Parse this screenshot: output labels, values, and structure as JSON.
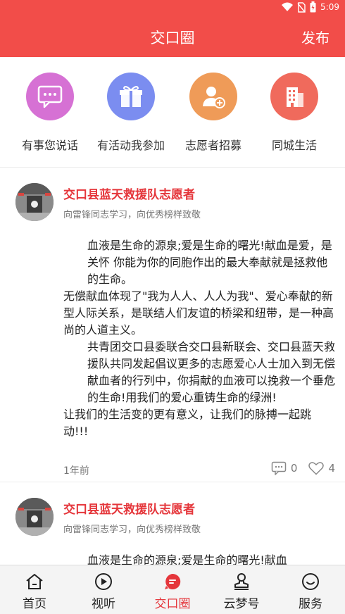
{
  "status_bar": {
    "time": "5:09"
  },
  "header": {
    "title": "交口圈",
    "publish_label": "发布"
  },
  "quick_links": [
    {
      "label": "有事您说话",
      "icon": "chat-bubble-icon",
      "color": "#d671d4"
    },
    {
      "label": "有活动我参加",
      "icon": "gift-icon",
      "color": "#7b8df0"
    },
    {
      "label": "志愿者招募",
      "icon": "add-person-icon",
      "color": "#ef9b58"
    },
    {
      "label": "同城生活",
      "icon": "building-icon",
      "color": "#f06a5c"
    }
  ],
  "posts": [
    {
      "author": "交口县蓝天救援队志愿者",
      "subtitle": "向雷锋同志学习，向优秀榜样致敬",
      "paragraphs": [
        "血液是生命的源泉;爱是生命的曙光!献血是爱，是关怀 你能为你的同胞作出的最大奉献就是拯救他的生命。",
        "无偿献血体现了\"我为人人、人人为我\"、爱心奉献的新型人际关系，是联结人们友谊的桥梁和纽带，是一种高尚的人道主义。",
        "共青团交口县委联合交口县新联会、交口县蓝天救援队共同发起倡议更多的志愿爱心人士加入到无偿献血者的行列中，你捐献的血液可以挽救一个垂危的生命!用我们的爱心重铸生命的绿洲!",
        "让我们的生活变的更有意义，让我们的脉搏一起跳动!!!"
      ],
      "time": "1年前",
      "comments": "0",
      "likes": "4"
    },
    {
      "author": "交口县蓝天救援队志愿者",
      "subtitle": "向雷锋同志学习，向优秀榜样致敬",
      "preview": "血液是生命的源泉;爱是生命的曙光!献血"
    }
  ],
  "tabs": [
    {
      "label": "首页",
      "icon": "home-icon"
    },
    {
      "label": "视听",
      "icon": "play-icon"
    },
    {
      "label": "交口圈",
      "icon": "chat-circle-icon",
      "active": true
    },
    {
      "label": "云梦号",
      "icon": "stamp-icon"
    },
    {
      "label": "服务",
      "icon": "smile-icon"
    }
  ],
  "colors": {
    "brand": "#f24d49",
    "author": "#e5363b"
  }
}
